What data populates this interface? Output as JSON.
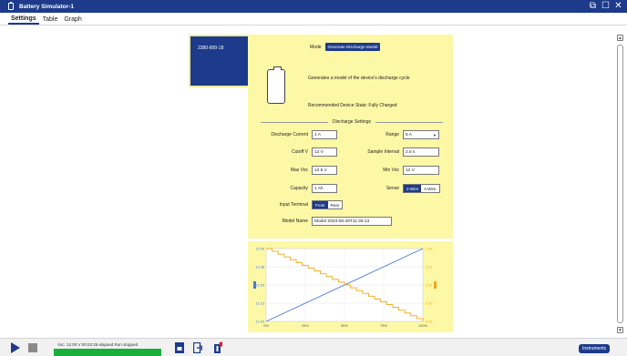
{
  "window": {
    "title": "Battery Simulator-1",
    "controls": [
      "restore",
      "maximize",
      "close"
    ]
  },
  "menu": {
    "tabs": [
      {
        "label": "Settings",
        "active": true
      },
      {
        "label": "Table",
        "active": false
      },
      {
        "label": "Graph",
        "active": false
      }
    ]
  },
  "device": {
    "serial": "2380-800-18"
  },
  "mode": {
    "label": "Mode",
    "value": "Generate Discharge Model",
    "description": "Generates a model of the device's discharge cycle",
    "recommended_state": "Recommended Device State: Fully Charged"
  },
  "discharge_settings": {
    "title": "Discharge Settings",
    "discharge_current": {
      "label": "Discharge Current",
      "value": "1 A"
    },
    "range": {
      "label": "Range",
      "value": "5 A"
    },
    "cutoff_v": {
      "label": "Cutoff V",
      "value": "12 V"
    },
    "sample_interval": {
      "label": "Sample Interval",
      "value": "2.5 s"
    },
    "max_voc": {
      "label": "Max Voc",
      "value": "12.5 V"
    },
    "min_voc": {
      "label": "Min Voc",
      "value": "12 V"
    },
    "capacity": {
      "label": "Capacity",
      "value": "1 Ah"
    },
    "sense": {
      "label": "Sense",
      "options": [
        "2-Wire",
        "4-Wire"
      ],
      "selected": "2-Wire"
    },
    "input_terminal": {
      "label": "Input Terminal",
      "options": [
        "Front",
        "Rear"
      ],
      "selected": "Front"
    },
    "model_name": {
      "label": "Model Name",
      "value": "Model 2023-06-29T11:35:13"
    }
  },
  "chart_data": {
    "type": "line",
    "x_ticks": [
      "0%",
      "25%",
      "50%",
      "75%",
      "100%"
    ],
    "left_ticks": [
      "12.50",
      "12.38",
      "12.25",
      "12.13",
      "12.00"
    ],
    "right_ticks": [
      "2.49",
      "0.51",
      "0.20",
      "0.20",
      "0.00"
    ],
    "series": [
      {
        "color": "#4a78d8",
        "x": [
          0,
          100
        ],
        "y": [
          12.0,
          12.5
        ]
      },
      {
        "color": "#f0a818",
        "x": [
          0,
          100
        ],
        "y": [
          12.5,
          12.0
        ],
        "stepped": true
      }
    ],
    "ylim": [
      12.0,
      12.5
    ],
    "grid": true
  },
  "bottom": {
    "status": "Voc: 12.00 V  00:02:25  elapsed  Run stopped",
    "progress": 1.0,
    "instruments_label": "Instruments",
    "colors": {
      "accent": "#1d3b8a",
      "progress": "#19b03a",
      "panel": "#fcf8a6"
    }
  }
}
